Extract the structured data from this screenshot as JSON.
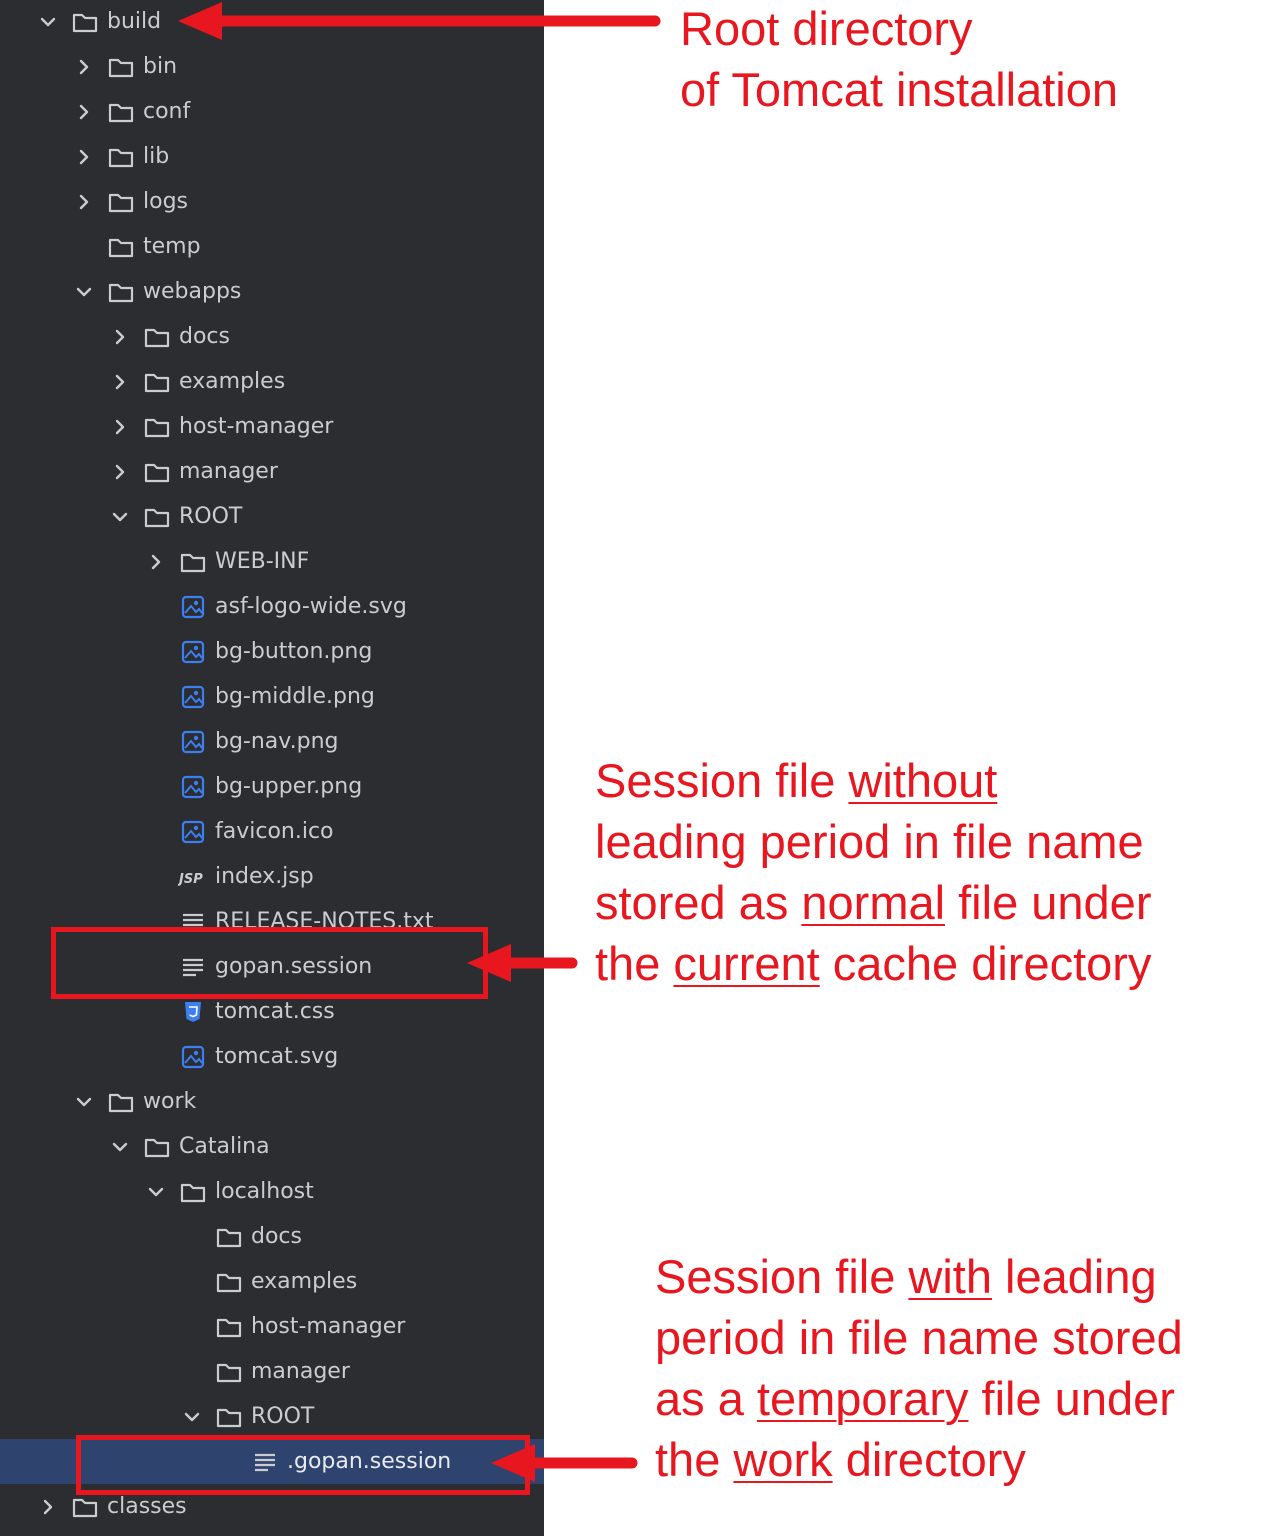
{
  "tree": {
    "rows": [
      {
        "label": "build",
        "depth": 0,
        "icon": "folder-icon",
        "chevron": "down"
      },
      {
        "label": "bin",
        "depth": 1,
        "icon": "folder-icon",
        "chevron": "right"
      },
      {
        "label": "conf",
        "depth": 1,
        "icon": "folder-icon",
        "chevron": "right"
      },
      {
        "label": "lib",
        "depth": 1,
        "icon": "folder-icon",
        "chevron": "right"
      },
      {
        "label": "logs",
        "depth": 1,
        "icon": "folder-icon",
        "chevron": "right"
      },
      {
        "label": "temp",
        "depth": 1,
        "icon": "folder-icon",
        "chevron": ""
      },
      {
        "label": "webapps",
        "depth": 1,
        "icon": "folder-icon",
        "chevron": "down"
      },
      {
        "label": "docs",
        "depth": 2,
        "icon": "folder-icon",
        "chevron": "right"
      },
      {
        "label": "examples",
        "depth": 2,
        "icon": "folder-icon",
        "chevron": "right"
      },
      {
        "label": "host-manager",
        "depth": 2,
        "icon": "folder-icon",
        "chevron": "right"
      },
      {
        "label": "manager",
        "depth": 2,
        "icon": "folder-icon",
        "chevron": "right"
      },
      {
        "label": "ROOT",
        "depth": 2,
        "icon": "folder-icon",
        "chevron": "down"
      },
      {
        "label": "WEB-INF",
        "depth": 3,
        "icon": "folder-icon",
        "chevron": "right"
      },
      {
        "label": "asf-logo-wide.svg",
        "depth": 3,
        "icon": "image-file-icon",
        "chevron": ""
      },
      {
        "label": "bg-button.png",
        "depth": 3,
        "icon": "image-file-icon",
        "chevron": ""
      },
      {
        "label": "bg-middle.png",
        "depth": 3,
        "icon": "image-file-icon",
        "chevron": ""
      },
      {
        "label": "bg-nav.png",
        "depth": 3,
        "icon": "image-file-icon",
        "chevron": ""
      },
      {
        "label": "bg-upper.png",
        "depth": 3,
        "icon": "image-file-icon",
        "chevron": ""
      },
      {
        "label": "favicon.ico",
        "depth": 3,
        "icon": "image-file-icon",
        "chevron": ""
      },
      {
        "label": "index.jsp",
        "depth": 3,
        "icon": "jsp-file-icon",
        "chevron": ""
      },
      {
        "label": "RELEASE-NOTES.txt",
        "depth": 3,
        "icon": "text-file-icon",
        "chevron": ""
      },
      {
        "label": "gopan.session",
        "depth": 3,
        "icon": "text-file-icon",
        "chevron": ""
      },
      {
        "label": "tomcat.css",
        "depth": 3,
        "icon": "css-file-icon",
        "chevron": ""
      },
      {
        "label": "tomcat.svg",
        "depth": 3,
        "icon": "image-file-icon",
        "chevron": ""
      },
      {
        "label": "work",
        "depth": 1,
        "icon": "folder-icon",
        "chevron": "down"
      },
      {
        "label": "Catalina",
        "depth": 2,
        "icon": "folder-icon",
        "chevron": "down"
      },
      {
        "label": "localhost",
        "depth": 3,
        "icon": "folder-icon",
        "chevron": "down"
      },
      {
        "label": "docs",
        "depth": 4,
        "icon": "folder-icon",
        "chevron": ""
      },
      {
        "label": "examples",
        "depth": 4,
        "icon": "folder-icon",
        "chevron": ""
      },
      {
        "label": "host-manager",
        "depth": 4,
        "icon": "folder-icon",
        "chevron": ""
      },
      {
        "label": "manager",
        "depth": 4,
        "icon": "folder-icon",
        "chevron": ""
      },
      {
        "label": "ROOT",
        "depth": 4,
        "icon": "folder-icon",
        "chevron": "down"
      },
      {
        "label": ".gopan.session",
        "depth": 5,
        "icon": "text-file-icon",
        "chevron": "",
        "selected": true
      },
      {
        "label": "classes",
        "depth": 0,
        "icon": "folder-icon",
        "chevron": "right"
      }
    ]
  },
  "annotations": {
    "root": {
      "lines": [
        [
          {
            "t": "Root directory"
          }
        ],
        [
          {
            "t": "of Tomcat installation"
          }
        ]
      ]
    },
    "normal_session": {
      "lines": [
        [
          {
            "t": "Session file "
          },
          {
            "t": "without",
            "u": true
          }
        ],
        [
          {
            "t": "leading period in file name"
          }
        ],
        [
          {
            "t": "stored as "
          },
          {
            "t": "normal",
            "u": true
          },
          {
            "t": " file under"
          }
        ],
        [
          {
            "t": "the "
          },
          {
            "t": "current",
            "u": true
          },
          {
            "t": " cache directory"
          }
        ]
      ]
    },
    "temp_session": {
      "lines": [
        [
          {
            "t": "Session file "
          },
          {
            "t": "with",
            "u": true
          },
          {
            "t": " leading"
          }
        ],
        [
          {
            "t": "period in file name stored"
          }
        ],
        [
          {
            "t": "as a "
          },
          {
            "t": "temporary",
            "u": true
          },
          {
            "t": " file under"
          }
        ],
        [
          {
            "t": "the "
          },
          {
            "t": "work",
            "u": true
          },
          {
            "t": " directory"
          }
        ]
      ]
    }
  },
  "colors": {
    "panel_bg": "#2b2d30",
    "selection_bg": "#2e436e",
    "text": "#c9ccd1",
    "annotation_red": "#e8161f",
    "image_icon": "#3d7ff0",
    "folder_icon": "#c9ccd1"
  }
}
